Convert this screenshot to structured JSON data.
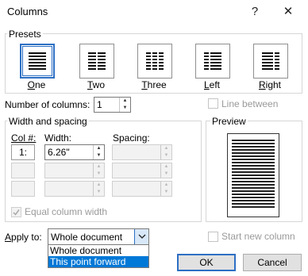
{
  "window": {
    "title": "Columns",
    "help_label": "?",
    "close_label": "✕"
  },
  "presets": {
    "group_label": "Presets",
    "items": [
      {
        "label": "One",
        "accel": "O",
        "rest": "ne",
        "selected": true
      },
      {
        "label": "Two",
        "accel": "T",
        "rest": "wo",
        "selected": false
      },
      {
        "label": "Three",
        "accel": "T",
        "rest": "hree",
        "selected": false
      },
      {
        "label": "Left",
        "accel": "L",
        "rest": "eft",
        "selected": false
      },
      {
        "label": "Right",
        "accel": "R",
        "rest": "ight",
        "selected": false
      }
    ]
  },
  "num_columns": {
    "label": "Number of columns:",
    "value": "1"
  },
  "line_between": {
    "label": "Line between",
    "checked": false
  },
  "width_spacing": {
    "group_label": "Width and spacing",
    "col_header": "Col #:",
    "width_header": "Width:",
    "spacing_header": "Spacing:",
    "rows": [
      {
        "col": "1:",
        "width": "6.26\"",
        "spacing": ""
      },
      {
        "col": "",
        "width": "",
        "spacing": ""
      },
      {
        "col": "",
        "width": "",
        "spacing": ""
      }
    ],
    "equal_width_label": "Equal column width",
    "equal_width_checked": true
  },
  "preview": {
    "label": "Preview"
  },
  "apply_to": {
    "label": "Apply to:",
    "value": "Whole document",
    "options": [
      "Whole document",
      "This point forward"
    ],
    "highlighted": "This point forward"
  },
  "start_new_column": {
    "label": "Start new column",
    "checked": false
  },
  "buttons": {
    "ok": "OK",
    "cancel": "Cancel"
  },
  "colors": {
    "accent": "#2d6fc4",
    "selection": "#0078d7"
  }
}
